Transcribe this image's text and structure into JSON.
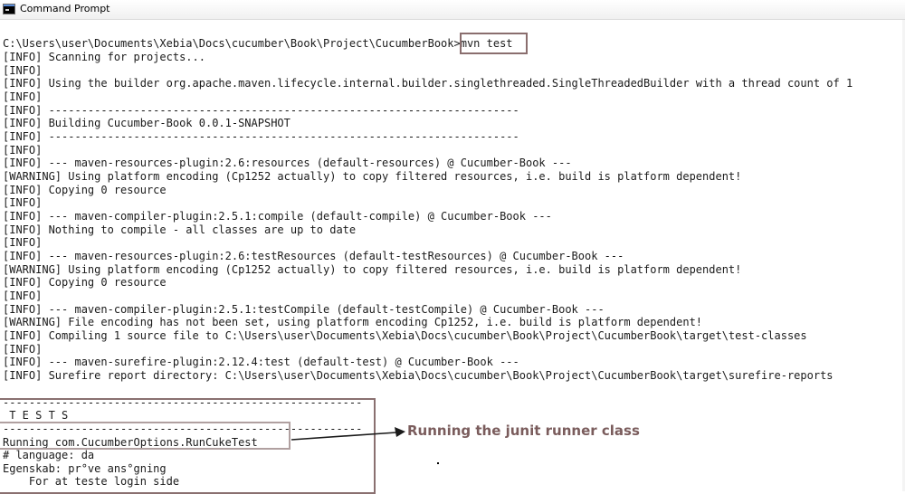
{
  "window": {
    "title": "Command Prompt",
    "icon": "cmd-icon"
  },
  "console": {
    "lines": [
      "",
      "C:\\Users\\user\\Documents\\Xebia\\Docs\\cucumber\\Book\\Project\\CucumberBook>mvn test",
      "[INFO] Scanning for projects...",
      "[INFO]",
      "[INFO] Using the builder org.apache.maven.lifecycle.internal.builder.singlethreaded.SingleThreadedBuilder with a thread count of 1",
      "[INFO]",
      "[INFO] ------------------------------------------------------------------------",
      "[INFO] Building Cucumber-Book 0.0.1-SNAPSHOT",
      "[INFO] ------------------------------------------------------------------------",
      "[INFO]",
      "[INFO] --- maven-resources-plugin:2.6:resources (default-resources) @ Cucumber-Book ---",
      "[WARNING] Using platform encoding (Cp1252 actually) to copy filtered resources, i.e. build is platform dependent!",
      "[INFO] Copying 0 resource",
      "[INFO]",
      "[INFO] --- maven-compiler-plugin:2.5.1:compile (default-compile) @ Cucumber-Book ---",
      "[INFO] Nothing to compile - all classes are up to date",
      "[INFO]",
      "[INFO] --- maven-resources-plugin:2.6:testResources (default-testResources) @ Cucumber-Book ---",
      "[WARNING] Using platform encoding (Cp1252 actually) to copy filtered resources, i.e. build is platform dependent!",
      "[INFO] Copying 0 resource",
      "[INFO]",
      "[INFO] --- maven-compiler-plugin:2.5.1:testCompile (default-testCompile) @ Cucumber-Book ---",
      "[WARNING] File encoding has not been set, using platform encoding Cp1252, i.e. build is platform dependent!",
      "[INFO] Compiling 1 source file to C:\\Users\\user\\Documents\\Xebia\\Docs\\cucumber\\Book\\Project\\CucumberBook\\target\\test-classes",
      "[INFO]",
      "[INFO] --- maven-surefire-plugin:2.12.4:test (default-test) @ Cucumber-Book ---",
      "[INFO] Surefire report directory: C:\\Users\\user\\Documents\\Xebia\\Docs\\cucumber\\Book\\Project\\CucumberBook\\target\\surefire-reports",
      "",
      "-------------------------------------------------------",
      " T E S T S",
      "-------------------------------------------------------",
      "Running com.CucumberOptions.RunCukeTest",
      "# language: da",
      "Egenskab: pr°ve ans°gning",
      "    For at teste login side"
    ]
  },
  "annotation": {
    "text": "Running the junit runner class"
  },
  "colors": {
    "highlight_box": "#8a6e6e",
    "annotation_text": "#7a5c5c"
  }
}
